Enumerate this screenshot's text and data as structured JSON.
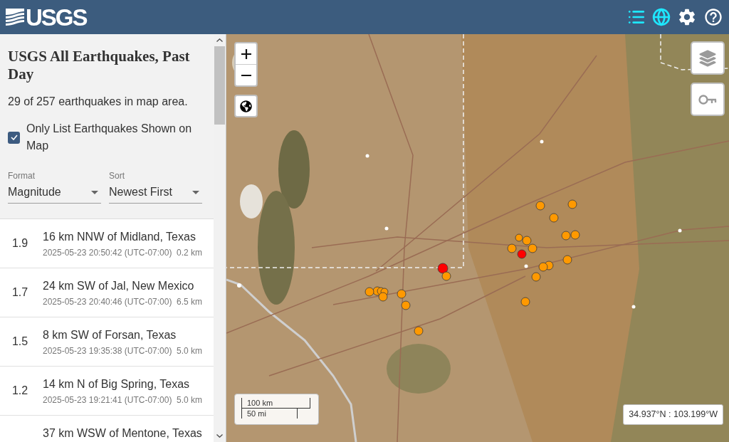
{
  "header": {
    "logo_text": "USGS",
    "icons": [
      {
        "kind": "list",
        "selected": true
      },
      {
        "kind": "map",
        "selected": true
      },
      {
        "kind": "settings",
        "selected": false
      },
      {
        "kind": "help",
        "selected": false
      }
    ]
  },
  "sidebar": {
    "title": "USGS All Earthquakes, Past Day",
    "count": "29 of 257 earthquakes in map area.",
    "filter": {
      "label": "Only List Earthquakes Shown on Map",
      "checked": true
    },
    "selects": [
      {
        "label": "Format",
        "value": "Magnitude"
      },
      {
        "label": "Sort",
        "value": "Newest First"
      }
    ],
    "earthquakes": [
      {
        "magnitude": "1.9",
        "place": "16 km NNW of Midland, Texas",
        "time": "2025-05-23 20:50:42 (UTC-07:00)",
        "depth": "0.2 km"
      },
      {
        "magnitude": "1.7",
        "place": "24 km SW of Jal, New Mexico",
        "time": "2025-05-23 20:40:46 (UTC-07:00)",
        "depth": "6.5 km"
      },
      {
        "magnitude": "1.5",
        "place": "8 km SW of Forsan, Texas",
        "time": "2025-05-23 19:35:38 (UTC-07:00)",
        "depth": "5.0 km"
      },
      {
        "magnitude": "1.2",
        "place": "14 km N of Big Spring, Texas",
        "time": "2025-05-23 19:21:41 (UTC-07:00)",
        "depth": "5.0 km"
      },
      {
        "place": "37 km WSW of Mentone, Texas"
      }
    ]
  },
  "map": {
    "markers": [
      {
        "color": "#ff9900"
      },
      {
        "color": "#ff9900"
      },
      {
        "color": "#ff9900"
      },
      {
        "color": "#ff9900"
      },
      {
        "color": "#ff9900"
      },
      {
        "color": "#ff9900"
      },
      {
        "color": "#ff9900"
      },
      {
        "color": "#ff9900"
      },
      {
        "color": "#ff9900"
      },
      {
        "color": "#ff0000"
      },
      {
        "color": "#ff9900"
      },
      {
        "color": "#ff9900"
      },
      {
        "color": "#ff9900"
      },
      {
        "color": "#ff0000"
      },
      {
        "color": "#ff9900"
      },
      {
        "color": "#ff9900"
      },
      {
        "color": "#ff9900"
      },
      {
        "color": "#ff9900"
      },
      {
        "color": "#ff9900"
      },
      {
        "color": "#ff9900"
      },
      {
        "color": "#ff9900"
      },
      {
        "color": "#ff9900"
      },
      {
        "color": "#ff9900"
      },
      {
        "color": "#ff9900"
      },
      {
        "color": "#ff9900"
      }
    ],
    "scale": {
      "metric": "100 km",
      "imperial": "50 mi"
    },
    "coordinates": "34.937°N : 103.199°W"
  }
}
